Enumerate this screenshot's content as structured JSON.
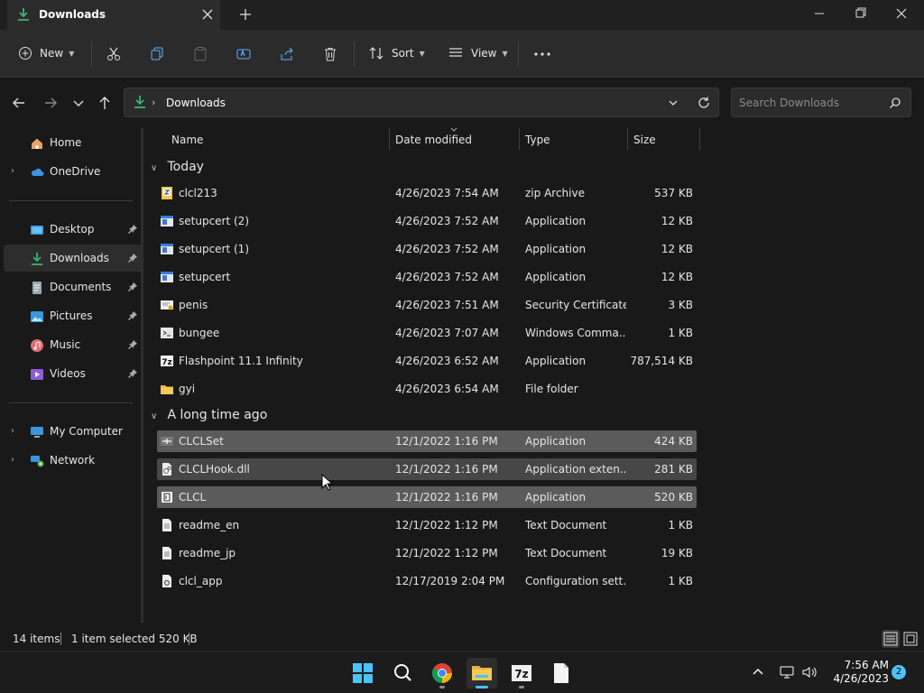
{
  "window": {
    "tab_title": "Downloads",
    "accent": "#4cc2ff"
  },
  "toolbar": {
    "new_label": "New",
    "sort_label": "Sort",
    "view_label": "View"
  },
  "address": {
    "path": "Downloads",
    "search_placeholder": "Search Downloads"
  },
  "sidebar": {
    "items": [
      {
        "label": "Home",
        "icon": "home-icon"
      },
      {
        "label": "OneDrive",
        "icon": "cloud-icon"
      },
      {
        "label": "Desktop",
        "icon": "desktop-icon"
      },
      {
        "label": "Downloads",
        "icon": "download-icon"
      },
      {
        "label": "Documents",
        "icon": "documents-icon"
      },
      {
        "label": "Pictures",
        "icon": "pictures-icon"
      },
      {
        "label": "Music",
        "icon": "music-icon"
      },
      {
        "label": "Videos",
        "icon": "videos-icon"
      },
      {
        "label": "My Computer",
        "icon": "computer-icon"
      },
      {
        "label": "Network",
        "icon": "network-icon"
      }
    ]
  },
  "columns": {
    "name": "Name",
    "date": "Date modified",
    "type": "Type",
    "size": "Size"
  },
  "groups": [
    {
      "label": "Today",
      "files": [
        {
          "name": "clcl213",
          "date": "4/26/2023 7:54 AM",
          "type": "zip Archive",
          "size": "537 KB",
          "icon": "zip-icon"
        },
        {
          "name": "setupcert (2)",
          "date": "4/26/2023 7:52 AM",
          "type": "Application",
          "size": "12 KB",
          "icon": "app-icon"
        },
        {
          "name": "setupcert (1)",
          "date": "4/26/2023 7:52 AM",
          "type": "Application",
          "size": "12 KB",
          "icon": "app-icon"
        },
        {
          "name": "setupcert",
          "date": "4/26/2023 7:52 AM",
          "type": "Application",
          "size": "12 KB",
          "icon": "app-icon"
        },
        {
          "name": "penis",
          "date": "4/26/2023 7:51 AM",
          "type": "Security Certificate",
          "size": "3 KB",
          "icon": "certificate-icon"
        },
        {
          "name": "bungee",
          "date": "4/26/2023 7:07 AM",
          "type": "Windows Comma...",
          "size": "1 KB",
          "icon": "script-icon"
        },
        {
          "name": "Flashpoint 11.1 Infinity",
          "date": "4/26/2023 6:52 AM",
          "type": "Application",
          "size": "787,514 KB",
          "icon": "7z-icon"
        },
        {
          "name": "gyi",
          "date": "4/26/2023 6:54 AM",
          "type": "File folder",
          "size": "",
          "icon": "folder-icon"
        }
      ]
    },
    {
      "label": "A long time ago",
      "files": [
        {
          "name": "CLCLSet",
          "date": "12/1/2022 1:16 PM",
          "type": "Application",
          "size": "424 KB",
          "icon": "app-icon"
        },
        {
          "name": "CLCLHook.dll",
          "date": "12/1/2022 1:16 PM",
          "type": "Application exten...",
          "size": "281 KB",
          "icon": "dll-icon"
        },
        {
          "name": "CLCL",
          "date": "12/1/2022 1:16 PM",
          "type": "Application",
          "size": "520 KB",
          "icon": "app-icon"
        },
        {
          "name": "readme_en",
          "date": "12/1/2022 1:12 PM",
          "type": "Text Document",
          "size": "1 KB",
          "icon": "text-file-icon"
        },
        {
          "name": "readme_jp",
          "date": "12/1/2022 1:12 PM",
          "type": "Text Document",
          "size": "19 KB",
          "icon": "text-file-icon"
        },
        {
          "name": "clcl_app",
          "date": "12/17/2019 2:04 PM",
          "type": "Configuration sett...",
          "size": "1 KB",
          "icon": "config-file-icon"
        }
      ]
    }
  ],
  "status": {
    "item_count": "14 items",
    "selection": "1 item selected  520 KB"
  },
  "taskbar": {
    "time": "7:56 AM",
    "date": "4/26/2023",
    "notification_count": "2"
  }
}
